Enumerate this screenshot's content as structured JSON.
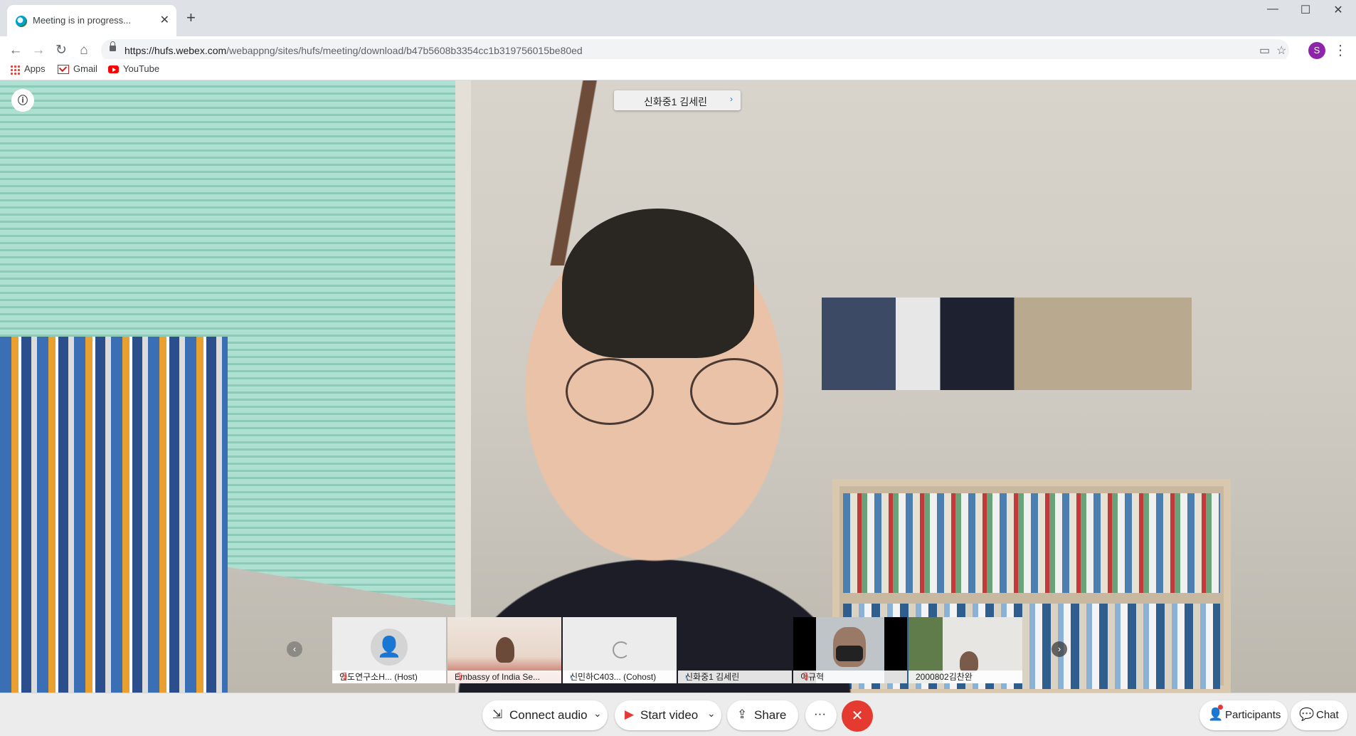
{
  "browser": {
    "tab_title": "Meeting is in progress...",
    "url_host": "https://hufs.webex.com",
    "url_path": "/webappng/sites/hufs/meeting/download/b47b5608b3354cc1b319756015be80ed",
    "profile_initial": "S",
    "bookmarks": [
      "Apps",
      "Gmail",
      "YouTube"
    ]
  },
  "meeting": {
    "active_speaker": "신화중1 김세린",
    "participants": [
      {
        "name": "인도연구소H... (Host)"
      },
      {
        "name": "Embassy of India Se..."
      },
      {
        "name": "신민하C403... (Cohost)"
      },
      {
        "name": "신화중1 김세린"
      },
      {
        "name": "이규혁"
      },
      {
        "name": "2000802김찬완"
      }
    ]
  },
  "controls": {
    "connect_audio": "Connect audio",
    "start_video": "Start video",
    "share": "Share",
    "more": "···",
    "participants": "Participants",
    "chat": "Chat"
  },
  "colors": {
    "end_button": "#e53a2f",
    "accent": "#1a73e8",
    "profile": "#8e24aa"
  }
}
